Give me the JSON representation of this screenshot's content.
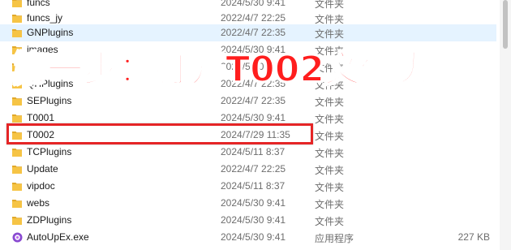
{
  "files": [
    {
      "name": "funcs",
      "date": "2024/5/30 9:41",
      "type": "文件夹",
      "size": "",
      "icon": "folder-icon"
    },
    {
      "name": "funcs_jy",
      "date": "2022/4/7 22:25",
      "type": "文件夹",
      "size": "",
      "icon": "folder-icon"
    },
    {
      "name": "GNPlugins",
      "date": "2022/4/7 22:35",
      "type": "文件夹",
      "size": "",
      "icon": "folder-icon"
    },
    {
      "name": "images",
      "date": "2024/5/30 9:41",
      "type": "文件夹",
      "size": "",
      "icon": "folder-icon"
    },
    {
      "name": "Lib",
      "date": "2024/5/30 9:41",
      "type": "文件夹",
      "size": "",
      "icon": "folder-icon"
    },
    {
      "name": "QHPlugins",
      "date": "2022/4/7 22:35",
      "type": "文件夹",
      "size": "",
      "icon": "folder-icon"
    },
    {
      "name": "SEPlugins",
      "date": "2022/4/7 22:35",
      "type": "文件夹",
      "size": "",
      "icon": "folder-icon"
    },
    {
      "name": "T0001",
      "date": "2024/5/30 9:41",
      "type": "文件夹",
      "size": "",
      "icon": "folder-icon"
    },
    {
      "name": "T0002",
      "date": "2024/7/29 11:35",
      "type": "文件夹",
      "size": "",
      "icon": "folder-icon"
    },
    {
      "name": "TCPlugins",
      "date": "2024/5/11 8:37",
      "type": "文件夹",
      "size": "",
      "icon": "folder-icon"
    },
    {
      "name": "Update",
      "date": "2022/4/7 22:25",
      "type": "文件夹",
      "size": "",
      "icon": "folder-icon"
    },
    {
      "name": "vipdoc",
      "date": "2024/5/11 8:37",
      "type": "文件夹",
      "size": "",
      "icon": "folder-icon"
    },
    {
      "name": "webs",
      "date": "2024/5/30 9:41",
      "type": "文件夹",
      "size": "",
      "icon": "folder-icon"
    },
    {
      "name": "ZDPlugins",
      "date": "2024/5/30 9:41",
      "type": "文件夹",
      "size": "",
      "icon": "folder-icon"
    },
    {
      "name": "AutoUpEx.exe",
      "date": "2024/5/30 9:41",
      "type": "应用程序",
      "size": "227 KB",
      "icon": "exe-app-icon"
    }
  ],
  "overlay": {
    "text": "第一步：打开T002文件夹"
  },
  "colors": {
    "folder": "#f6c445",
    "folder_dark": "#e2a92a",
    "highlight_border": "#e52526",
    "overlay_text": "#ff1e1e",
    "hover_row": "#e5f3ff"
  }
}
